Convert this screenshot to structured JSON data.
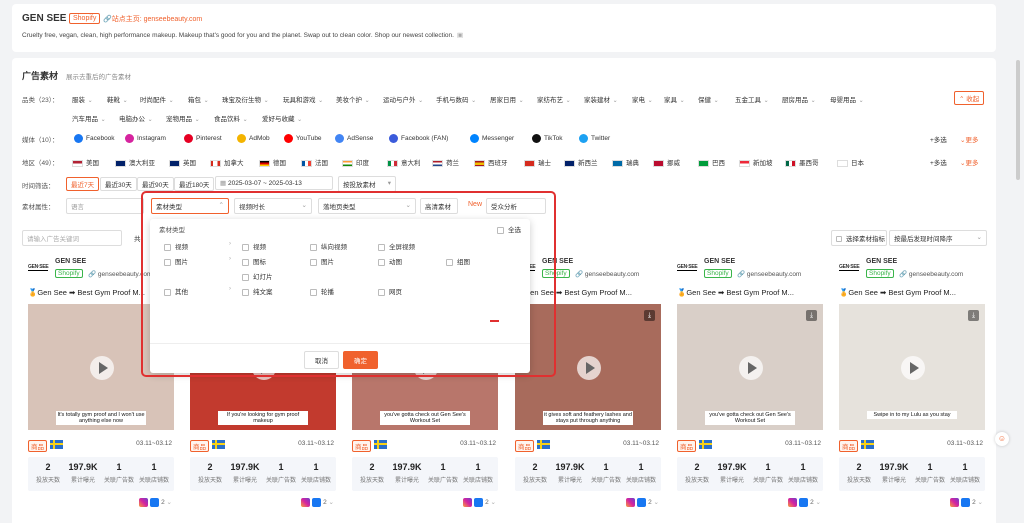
{
  "header": {
    "brand": "GEN SEE",
    "platform_tag": "Shopify",
    "site_label": "站点主页: genseebeauty.com",
    "description": "Cruelty free, vegan, clean, high performance makeup. Makeup that's good for you and the planet. Swap out to clean color. Shop our newest collection."
  },
  "section": {
    "title": "广告素材",
    "subtitle": "展示去重后的广告素材"
  },
  "filters": {
    "category_label": "品类（23）：",
    "categories_row1": [
      "服装",
      "鞋靴",
      "时尚配件",
      "箱包",
      "珠宝及衍生物",
      "玩具和游戏",
      "美妆个护",
      "运动与户外",
      "手机与数码",
      "居家日用",
      "家纺布艺",
      "家装建材",
      "家电",
      "家具",
      "保健",
      "五金工具",
      "厨房用品",
      "母婴用品"
    ],
    "categories_row2": [
      "汽车用品",
      "电脑办公",
      "宠物用品",
      "食品饮料",
      "爱好与收藏"
    ],
    "collapse_label": "收起",
    "media_label": "媒体（10）：",
    "media": [
      "Facebook",
      "Instagram",
      "Pinterest",
      "AdMob",
      "YouTube",
      "AdSense",
      "Facebook (FAN)",
      "Messenger",
      "TikTok",
      "Twitter"
    ],
    "multi_select": "+多选",
    "more": "更多",
    "region_label": "地区（49）：",
    "regions": [
      "美国",
      "澳大利亚",
      "英国",
      "加拿大",
      "德国",
      "法国",
      "印度",
      "意大利",
      "荷兰",
      "西班牙",
      "瑞士",
      "新西兰",
      "瑞典",
      "挪威",
      "巴西",
      "新加坡",
      "墨西哥",
      "日本"
    ],
    "time_label": "时间筛选：",
    "time_options": [
      "最近7天",
      "最近30天",
      "最近90天",
      "最近180天"
    ],
    "date_range": "2025-03-07 ~ 2025-03-13",
    "by_placement": "按投放素材",
    "attr_label": "素材属性：",
    "language_placeholder": "语言",
    "material_type_placeholder": "素材类型",
    "video_duration_placeholder": "视频时长",
    "landing_type_placeholder": "落地页类型",
    "hd_label": "高清素材",
    "new_badge": "New",
    "audience_label": "受众分析",
    "search_placeholder": "请输入广告关键词",
    "search_suffix": "共",
    "select_metric": "选择素材指标",
    "sort_label": "按最后发现时间降序"
  },
  "dropdown": {
    "title": "素材类型",
    "select_all": "全选",
    "col1": [
      "视频",
      "图片",
      "其他"
    ],
    "video_items": [
      "视频",
      "纵向视频",
      "全屏视频"
    ],
    "image_items": [
      "图标",
      "图片",
      "动图",
      "组图",
      "幻灯片"
    ],
    "other_items": [
      "纯文案",
      "轮播",
      "网页"
    ],
    "cancel": "取消",
    "confirm": "确定"
  },
  "cards": [
    {
      "brand": "GEN SEE",
      "shop": "Shopify",
      "domain": "genseebeauty.com",
      "title": "🏅Gen See ➡ Best Gym Proof M...",
      "caption": "It's totally gym proof and I won't use anything else now",
      "badge": "商品",
      "date": "03.11~03.12",
      "stats": [
        "2",
        "197.9K",
        "1",
        "1"
      ],
      "count": "2"
    },
    {
      "brand": "GEN SEE",
      "shop": "Shopify",
      "domain": "genseebeauty.com",
      "title": "🏅Gen See ➡ Best Gym Proof M...",
      "caption": "If you're looking for gym proof makeup",
      "badge": "商品",
      "date": "03.11~03.12",
      "stats": [
        "2",
        "197.9K",
        "1",
        "1"
      ],
      "count": "2"
    },
    {
      "brand": "GEN SEE",
      "shop": "Shopify",
      "domain": "genseebeauty.com",
      "title": "🏅Gen See ➡ Best Gym Proof M...",
      "caption": "you've gotta check out Gen See's Workout Set",
      "badge": "商品",
      "date": "03.11~03.12",
      "stats": [
        "2",
        "197.9K",
        "1",
        "1"
      ],
      "count": "2"
    },
    {
      "brand": "GEN SEE",
      "shop": "Shopify",
      "domain": "genseebeauty.com",
      "title": "🏅Gen See ➡ Best Gym Proof M...",
      "caption": "it gives soft and feathery lashes and stays put through anything",
      "badge": "商品",
      "date": "03.11~03.12",
      "stats": [
        "2",
        "197.9K",
        "1",
        "1"
      ],
      "count": "2"
    },
    {
      "brand": "GEN SEE",
      "shop": "Shopify",
      "domain": "genseebeauty.com",
      "title": "🏅Gen See ➡ Best Gym Proof M...",
      "caption": "you've gotta check out Gen See's Workout Set",
      "badge": "商品",
      "date": "03.11~03.12",
      "stats": [
        "2",
        "197.9K",
        "1",
        "1"
      ],
      "count": "2"
    },
    {
      "brand": "GEN SEE",
      "shop": "Shopify",
      "domain": "genseebeauty.com",
      "title": "🏅Gen See ➡ Best Gym Proof M...",
      "caption": "Swipe in to my Lulu as you stay",
      "badge": "商品",
      "date": "03.11~03.12",
      "stats": [
        "2",
        "197.9K",
        "1",
        "1"
      ],
      "count": "2"
    }
  ],
  "stat_labels": [
    "投放天数",
    "累计曝光",
    "关联广告数",
    "关联店铺数"
  ],
  "colors": {
    "accent": "#f0612d",
    "highlight_box": "#e03030",
    "shopify_green": "#3ab54a"
  }
}
